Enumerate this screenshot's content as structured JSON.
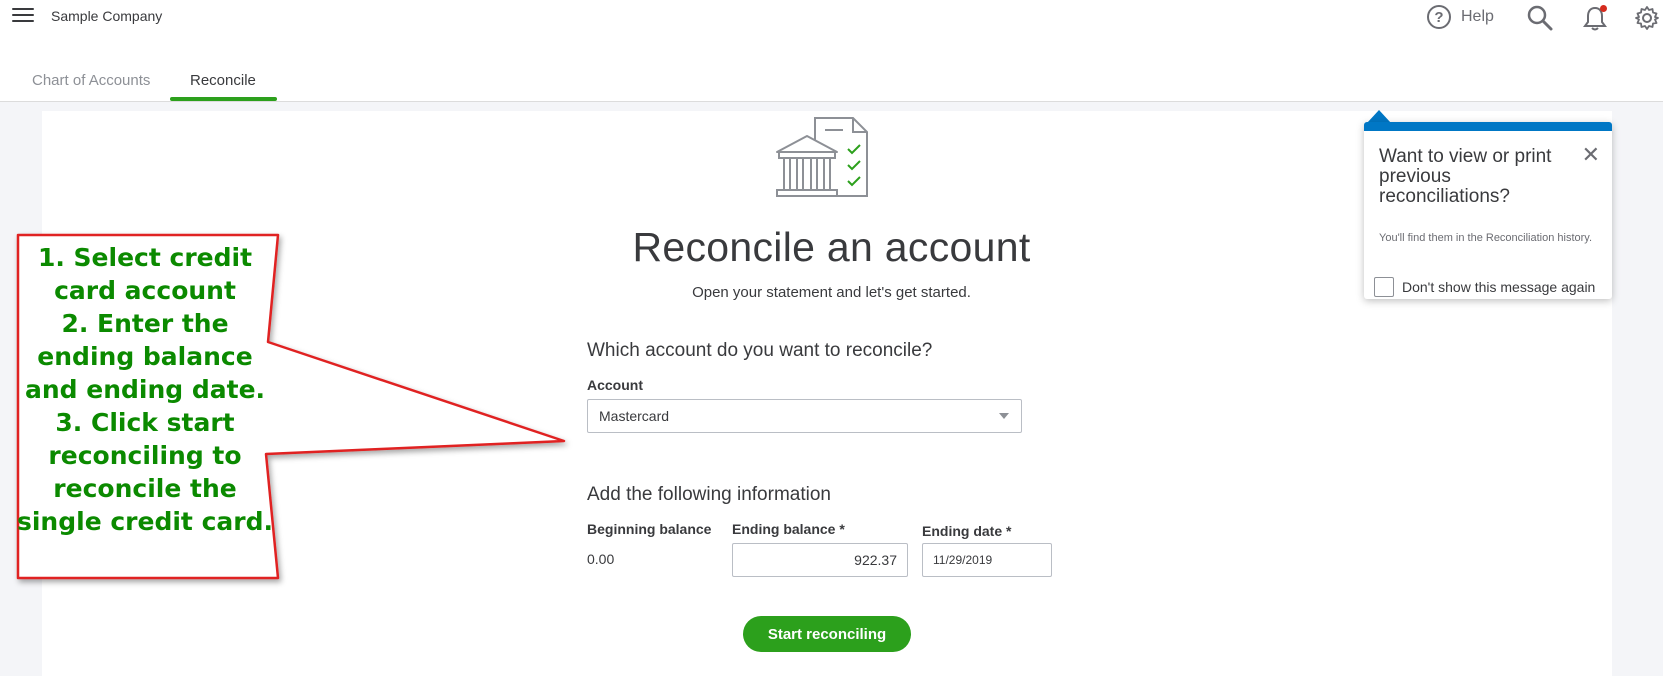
{
  "header": {
    "company_name": "Sample Company",
    "help_label": "Help",
    "help_icon_glyph": "?"
  },
  "tabs": [
    {
      "label": "Chart of Accounts",
      "active": false
    },
    {
      "label": "Reconcile",
      "active": true
    }
  ],
  "main": {
    "title": "Reconcile an account",
    "subtitle": "Open your statement and let's get started.",
    "account_section_heading": "Which account do you want to reconcile?",
    "account_label": "Account",
    "account_value": "Mastercard",
    "info_section_heading": "Add the following information",
    "beginning_balance_label": "Beginning balance",
    "beginning_balance_value": "0.00",
    "ending_balance_label": "Ending balance *",
    "ending_balance_value": "922.37",
    "ending_date_label": "Ending date *",
    "ending_date_value": "11/29/2019",
    "start_button_label": "Start reconciling"
  },
  "popover": {
    "title": "Want to view or print previous reconciliations?",
    "body": "You'll find them in the Reconciliation history.",
    "checkbox_label": "Don't show this message again",
    "checkbox_checked": false,
    "close_glyph": "✕"
  },
  "callout": {
    "lines": [
      "1. Select credit",
      "card account",
      "2. Enter the",
      "ending balance",
      "and ending date.",
      "3. Click start",
      "reconciling to",
      "reconcile the",
      "single credit card."
    ]
  },
  "colors": {
    "accent_green": "#2ca01c",
    "popover_blue": "#0077c5",
    "callout_border": "#e02020",
    "callout_text": "#0b8a00",
    "notification_dot": "#d52b1e"
  },
  "icons": [
    "hamburger-icon",
    "help-icon",
    "search-icon",
    "bell-icon",
    "gear-icon",
    "bank-statement-icon",
    "close-icon",
    "dropdown-caret-icon"
  ]
}
